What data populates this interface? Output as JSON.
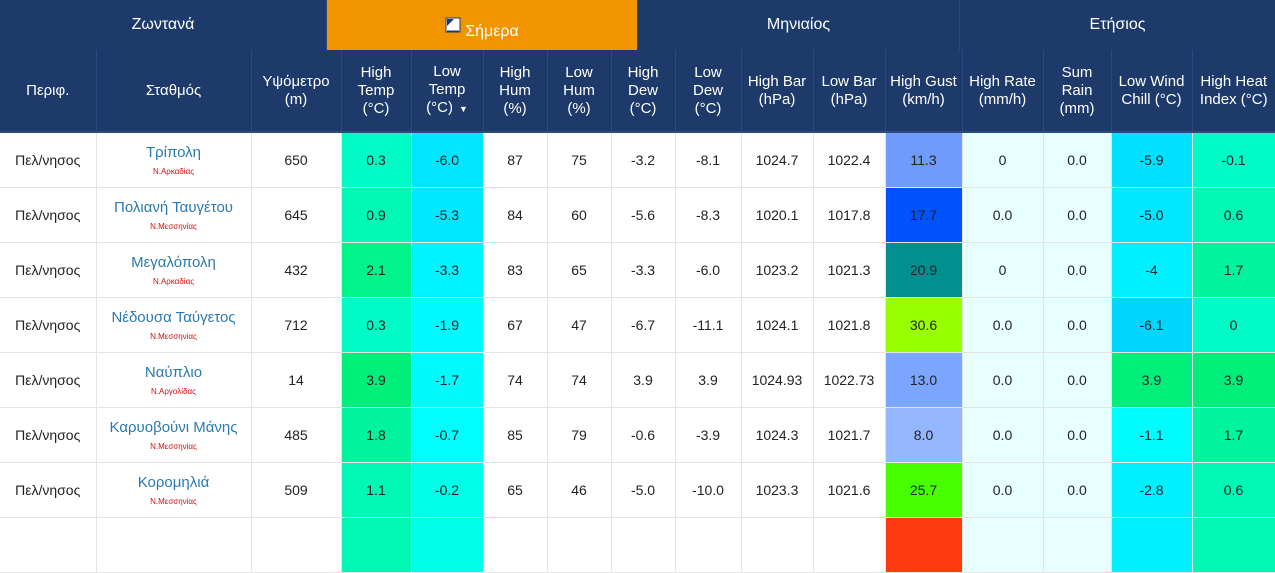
{
  "tabs": [
    {
      "label": "Ζωντανά",
      "active": false
    },
    {
      "label": "Σήμερα",
      "active": true
    },
    {
      "label": "Μηνιαίος",
      "active": false
    },
    {
      "label": "Ετήσιος",
      "active": false
    }
  ],
  "columns": [
    "Περιφ.",
    "Σταθμός",
    "Υψόμετρο (m)",
    "High Temp (°C)",
    "Low Temp (°C)",
    "High Hum (%)",
    "Low Hum (%)",
    "High Dew (°C)",
    "Low Dew (°C)",
    "High Bar (hPa)",
    "Low Bar (hPa)",
    "High Gust (km/h)",
    "High Rate (mm/h)",
    "Sum Rain (mm)",
    "Low Wind Chill (°C)",
    "High Heat Index (°C)"
  ],
  "rows": [
    {
      "region": "Πελ/νησος",
      "station": "Τρίπολη",
      "prefecture": "Ν.Αρκαδίας",
      "alt": "650",
      "hi_temp": "0.3",
      "lo_temp": "-6.0",
      "hi_hum": "87",
      "lo_hum": "75",
      "hi_dew": "-3.2",
      "lo_dew": "-8.1",
      "hi_bar": "1024.7",
      "lo_bar": "1022.4",
      "hi_gust": "11.3",
      "hi_rate": "0",
      "sum_rain": "0.0",
      "lo_chill": "-5.9",
      "hi_heat": "-0.1",
      "colors": {
        "hi_temp": "#00fbc6",
        "lo_temp": "#00e6ff",
        "hi_gust": "#6f9bff",
        "hi_rate": "#e8ffff",
        "sum_rain": "#e8ffff",
        "lo_chill": "#00e1ff",
        "hi_heat": "#00fbc6"
      }
    },
    {
      "region": "Πελ/νησος",
      "station": "Πολιανή Ταυγέτου",
      "prefecture": "Ν.Μεσσηνίας",
      "alt": "645",
      "hi_temp": "0.9",
      "lo_temp": "-5.3",
      "hi_hum": "84",
      "lo_hum": "60",
      "hi_dew": "-5.6",
      "lo_dew": "-8.3",
      "hi_bar": "1020.1",
      "lo_bar": "1017.8",
      "hi_gust": "17.7",
      "hi_rate": "0.0",
      "sum_rain": "0.0",
      "lo_chill": "-5.0",
      "hi_heat": "0.6",
      "colors": {
        "hi_temp": "#00f8b4",
        "lo_temp": "#00e8ff",
        "hi_gust": "#0053ff",
        "hi_rate": "#e8ffff",
        "sum_rain": "#e8ffff",
        "lo_chill": "#00e8ff",
        "hi_heat": "#00f8b4"
      }
    },
    {
      "region": "Πελ/νησος",
      "station": "Μεγαλόπολη",
      "prefecture": "Ν.Αρκαδίας",
      "alt": "432",
      "hi_temp": "2.1",
      "lo_temp": "-3.3",
      "hi_hum": "83",
      "lo_hum": "65",
      "hi_dew": "-3.3",
      "lo_dew": "-6.0",
      "hi_bar": "1023.2",
      "lo_bar": "1021.3",
      "hi_gust": "20.9",
      "hi_rate": "0",
      "sum_rain": "0.0",
      "lo_chill": "-4",
      "hi_heat": "1.7",
      "colors": {
        "hi_temp": "#00f48a",
        "lo_temp": "#00f4ff",
        "hi_gust": "#009090",
        "hi_rate": "#e8ffff",
        "sum_rain": "#e8ffff",
        "lo_chill": "#00f0ff",
        "hi_heat": "#00f49e"
      }
    },
    {
      "region": "Πελ/νησος",
      "station": "Νέδουσα Ταύγετος",
      "prefecture": "Ν.Μεσσηνίας",
      "alt": "712",
      "hi_temp": "0.3",
      "lo_temp": "-1.9",
      "hi_hum": "67",
      "lo_hum": "47",
      "hi_dew": "-6.7",
      "lo_dew": "-11.1",
      "hi_bar": "1024.1",
      "lo_bar": "1021.8",
      "hi_gust": "30.6",
      "hi_rate": "0.0",
      "sum_rain": "0.0",
      "lo_chill": "-6.1",
      "hi_heat": "0",
      "colors": {
        "hi_temp": "#00fbc6",
        "lo_temp": "#00faff",
        "hi_gust": "#98ff00",
        "hi_rate": "#e8ffff",
        "sum_rain": "#e8ffff",
        "lo_chill": "#00d6ff",
        "hi_heat": "#00fbc6"
      }
    },
    {
      "region": "Πελ/νησος",
      "station": "Ναύπλιο",
      "prefecture": "Ν.Αργολίδας",
      "alt": "14",
      "hi_temp": "3.9",
      "lo_temp": "-1.7",
      "hi_hum": "74",
      "lo_hum": "74",
      "hi_dew": "3.9",
      "lo_dew": "3.9",
      "hi_bar": "1024.93",
      "lo_bar": "1022.73",
      "hi_gust": "13.0",
      "hi_rate": "0.0",
      "sum_rain": "0.0",
      "lo_chill": "3.9",
      "hi_heat": "3.9",
      "colors": {
        "hi_temp": "#00ef7a",
        "lo_temp": "#00fbff",
        "hi_gust": "#7ba6ff",
        "hi_rate": "#e8ffff",
        "sum_rain": "#e8ffff",
        "lo_chill": "#00ef7a",
        "hi_heat": "#00ef7a"
      }
    },
    {
      "region": "Πελ/νησος",
      "station": "Καρυοβούνι Μάνης",
      "prefecture": "Ν.Μεσσηνίας",
      "alt": "485",
      "hi_temp": "1.8",
      "lo_temp": "-0.7",
      "hi_hum": "85",
      "lo_hum": "79",
      "hi_dew": "-0.6",
      "lo_dew": "-3.9",
      "hi_bar": "1024.3",
      "lo_bar": "1021.7",
      "hi_gust": "8.0",
      "hi_rate": "0.0",
      "sum_rain": "0.0",
      "lo_chill": "-1.1",
      "hi_heat": "1.7",
      "colors": {
        "hi_temp": "#00f49e",
        "lo_temp": "#00feff",
        "hi_gust": "#93b6ff",
        "hi_rate": "#e8ffff",
        "sum_rain": "#e8ffff",
        "lo_chill": "#00fcff",
        "hi_heat": "#00f49e"
      }
    },
    {
      "region": "Πελ/νησος",
      "station": "Κορομηλιά",
      "prefecture": "Ν.Μεσσηνίας",
      "alt": "509",
      "hi_temp": "1.1",
      "lo_temp": "-0.2",
      "hi_hum": "65",
      "lo_hum": "46",
      "hi_dew": "-5.0",
      "lo_dew": "-10.0",
      "hi_bar": "1023.3",
      "lo_bar": "1021.6",
      "hi_gust": "25.7",
      "hi_rate": "0.0",
      "sum_rain": "0.0",
      "lo_chill": "-2.8",
      "hi_heat": "0.6",
      "colors": {
        "hi_temp": "#00f8b4",
        "lo_temp": "#00ffe9",
        "hi_gust": "#48ff00",
        "hi_rate": "#e8ffff",
        "sum_rain": "#e8ffff",
        "lo_chill": "#00f0ff",
        "hi_heat": "#00f8b4"
      }
    }
  ],
  "row8": {
    "colors": {
      "hi_temp": "#00f8b4",
      "lo_temp": "#00ffe9",
      "hi_gust": "#ff3a10",
      "hi_rate": "#e8ffff",
      "sum_rain": "#e8ffff",
      "lo_chill": "#00f0ff",
      "hi_heat": "#00f8b4"
    }
  }
}
